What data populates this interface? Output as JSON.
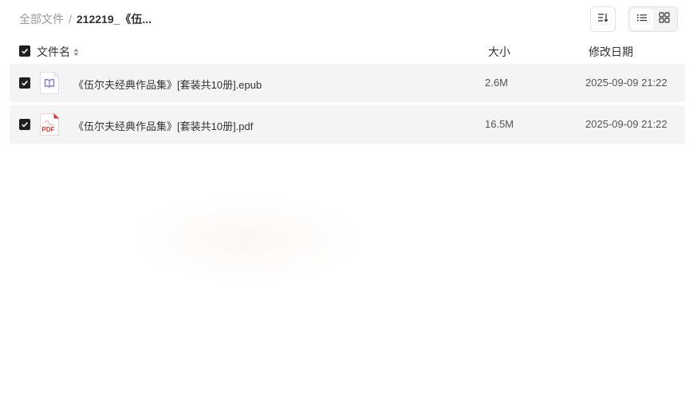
{
  "breadcrumb": {
    "root": "全部文件",
    "separator": "/",
    "current": "212219_《伍..."
  },
  "toolbar": {
    "sort_icon": "sort-lines-icon",
    "list_view_icon": "list-view-icon",
    "grid_view_icon": "grid-view-icon",
    "active_view": "list"
  },
  "table": {
    "headers": {
      "name": "文件名",
      "size": "大小",
      "date": "修改日期"
    },
    "select_all_checked": true,
    "rows": [
      {
        "name": "《伍尔夫经典作品集》[套装共10册].epub",
        "size": "2.6M",
        "date": "2025-09-09 21:22",
        "icon": "epub-file-icon",
        "checked": true
      },
      {
        "name": "《伍尔夫经典作品集》[套装共10册].pdf",
        "size": "16.5M",
        "date": "2025-09-09 21:22",
        "icon": "pdf-file-icon",
        "checked": true
      }
    ]
  },
  "colors": {
    "row_background": "#f4f4f5",
    "checkbox": "#1f1f1f",
    "epub_accent": "#7b6fd6",
    "pdf_accent": "#e5322d"
  }
}
